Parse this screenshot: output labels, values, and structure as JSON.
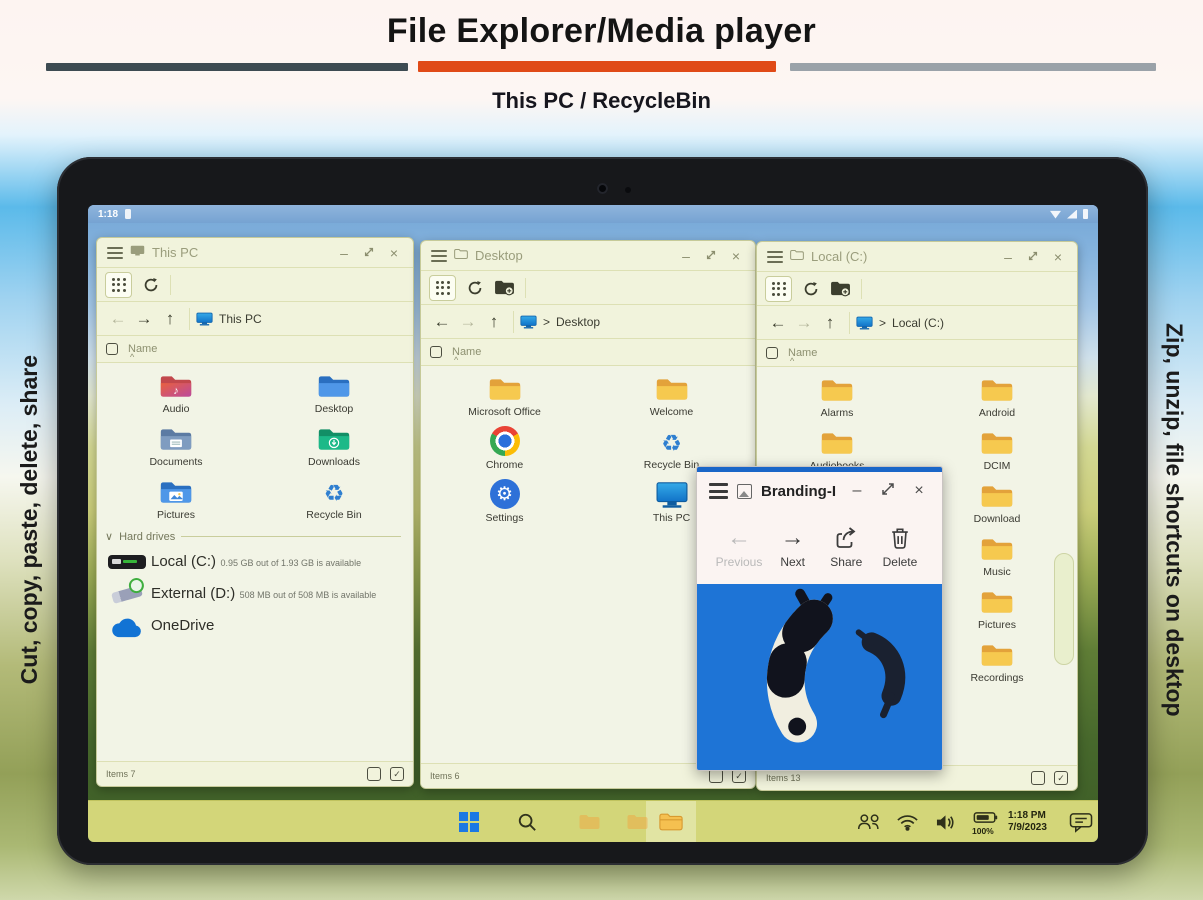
{
  "header": {
    "title": "File Explorer/Media player",
    "subtitle": "This PC / RecycleBin"
  },
  "side_labels": {
    "left": "Cut, copy, paste, delete, share",
    "right": "Zip, unzip, file shortcuts on desktop"
  },
  "colors": {
    "accent_orange": "#e04a17",
    "bar_dark": "#3d4b52",
    "bar_gray": "#9aa2a9",
    "taskbar_green": "#d3d679",
    "viewer_blue": "#1e74d6",
    "drive_used_red": "#e03a2f"
  },
  "android_status": {
    "time": "1:18"
  },
  "chrome_glyphs": {
    "minimize": "–",
    "close": "×"
  },
  "nav_glyphs": {
    "back": "←",
    "forward": "→",
    "up": "↑",
    "sort": "^",
    "section_chevron": "∨",
    "check": "✓",
    "crumb_sep": ">"
  },
  "windows": {
    "this_pc": {
      "title": "This PC",
      "breadcrumb": "This PC",
      "column_header": "Name",
      "items": [
        {
          "label": "Audio",
          "icon": "audio-folder"
        },
        {
          "label": "Desktop",
          "icon": "desktop-folder"
        },
        {
          "label": "Documents",
          "icon": "documents-folder"
        },
        {
          "label": "Downloads",
          "icon": "downloads-folder"
        },
        {
          "label": "Pictures",
          "icon": "pictures-folder"
        },
        {
          "label": "Recycle Bin",
          "icon": "recycle-bin"
        }
      ],
      "section_header": "Hard drives",
      "drives": [
        {
          "name": "Local (C:)",
          "detail": "0.95 GB out of 1.93 GB is available",
          "icon": "hdd"
        },
        {
          "name": "External (D:)",
          "detail": "508 MB out of 508 MB is available",
          "icon": "usb-drive"
        },
        {
          "name": "OneDrive",
          "detail": "",
          "icon": "onedrive-cloud"
        }
      ],
      "status": "Items 7"
    },
    "desktop": {
      "title": "Desktop",
      "breadcrumb": "Desktop",
      "column_header": "Name",
      "items": [
        {
          "label": "Microsoft Office",
          "icon": "folder"
        },
        {
          "label": "Welcome",
          "icon": "folder"
        },
        {
          "label": "Chrome",
          "icon": "chrome"
        },
        {
          "label": "Recycle Bin",
          "icon": "recycle-bin"
        },
        {
          "label": "Settings",
          "icon": "settings-gear"
        },
        {
          "label": "This PC",
          "icon": "monitor"
        }
      ],
      "status": "Items 6"
    },
    "local_c": {
      "title": "Local (C:)",
      "breadcrumb": "Local (C:)",
      "column_header": "Name",
      "items": [
        {
          "label": "Alarms",
          "icon": "folder"
        },
        {
          "label": "Android",
          "icon": "folder"
        },
        {
          "label": "Audiobooks",
          "icon": "folder"
        },
        {
          "label": "DCIM",
          "icon": "folder"
        },
        {
          "label": "Download",
          "icon": "folder"
        },
        {
          "label": "Music",
          "icon": "folder"
        },
        {
          "label": "Pictures",
          "icon": "folder"
        },
        {
          "label": "Recordings",
          "icon": "folder"
        }
      ],
      "status": "Items 13"
    },
    "viewer": {
      "title": "Branding-I",
      "buttons": {
        "previous": "Previous",
        "next": "Next",
        "share": "Share",
        "delete": "Delete"
      }
    }
  },
  "taskbar": {
    "time": "1:18 PM",
    "date": "7/9/2023",
    "battery": "100%"
  }
}
